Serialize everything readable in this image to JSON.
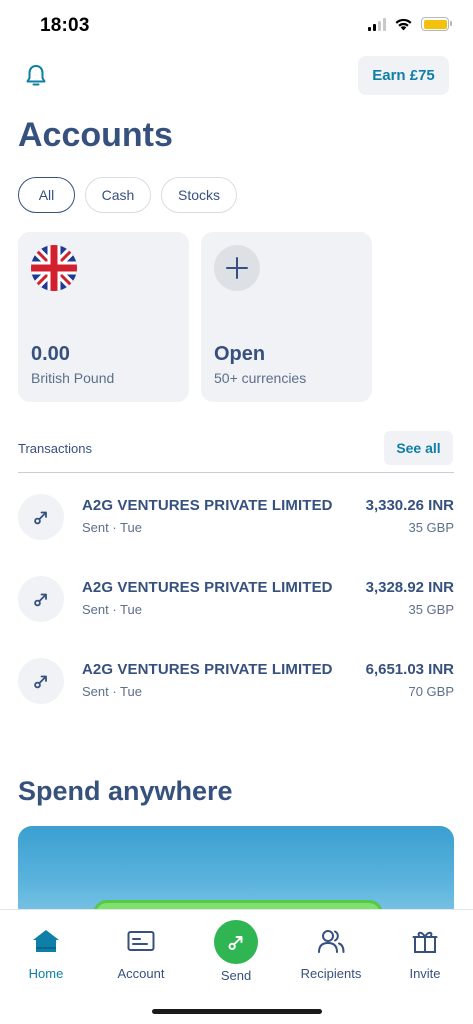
{
  "status_bar": {
    "time": "18:03"
  },
  "header": {
    "earn_label": "Earn £75",
    "title": "Accounts"
  },
  "filters": [
    {
      "label": "All",
      "active": true
    },
    {
      "label": "Cash",
      "active": false
    },
    {
      "label": "Stocks",
      "active": false
    }
  ],
  "accounts": [
    {
      "amount": "0.00",
      "label": "British Pound",
      "icon": "uk-flag-icon"
    },
    {
      "amount": "Open",
      "label": "50+ currencies",
      "icon": "plus-icon"
    }
  ],
  "transactions": {
    "section_label": "Transactions",
    "see_all_label": "See all",
    "items": [
      {
        "name": "A2G VENTURES PRIVATE LIMITED",
        "meta": "Sent · Tue",
        "amount": "3,330.26 INR",
        "sub_amount": "35 GBP"
      },
      {
        "name": "A2G VENTURES PRIVATE LIMITED",
        "meta": "Sent · Tue",
        "amount": "3,328.92 INR",
        "sub_amount": "35 GBP"
      },
      {
        "name": "A2G VENTURES PRIVATE LIMITED",
        "meta": "Sent · Tue",
        "amount": "6,651.03 INR",
        "sub_amount": "70 GBP"
      }
    ]
  },
  "spend": {
    "title": "Spend anywhere"
  },
  "nav": [
    {
      "label": "Home",
      "icon": "home-icon",
      "active": true
    },
    {
      "label": "Account",
      "icon": "card-icon",
      "active": false
    },
    {
      "label": "Send",
      "icon": "send-icon",
      "active": false
    },
    {
      "label": "Recipients",
      "icon": "recipients-icon",
      "active": false
    },
    {
      "label": "Invite",
      "icon": "gift-icon",
      "active": false
    }
  ],
  "colors": {
    "primary_text": "#37517e",
    "accent": "#0e7fa6",
    "send_green": "#2fb552",
    "card_bg": "#f0f2f5"
  }
}
